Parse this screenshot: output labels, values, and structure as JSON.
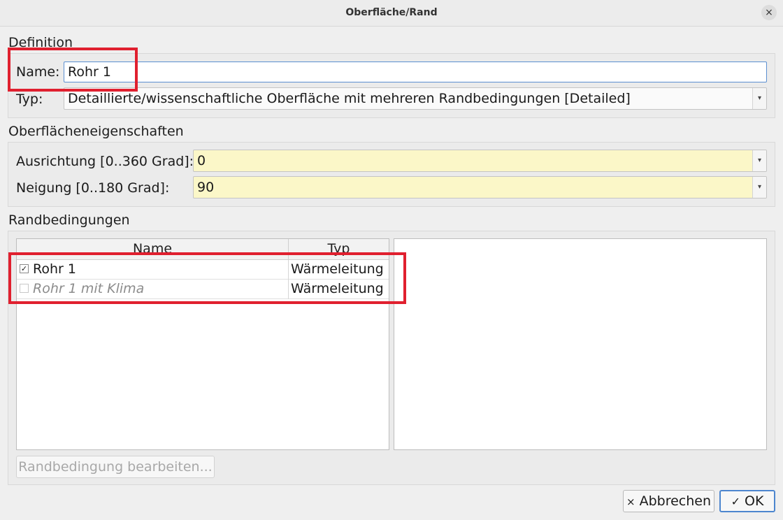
{
  "window": {
    "title": "Oberfläche/Rand",
    "close_glyph": "×"
  },
  "definition": {
    "section_label": "Definition",
    "name_label": "Name:",
    "name_value": "Rohr 1",
    "type_label": "Typ:",
    "type_value": "Detaillierte/wissenschaftliche Oberfläche mit mehreren Randbedingungen [Detailed]"
  },
  "surface": {
    "section_label": "Oberflächeneigenschaften",
    "orientation_label": "Ausrichtung [0..360 Grad]:",
    "orientation_value": "0",
    "inclination_label": "Neigung [0..180 Grad]:",
    "inclination_value": "90"
  },
  "boundary": {
    "section_label": "Randbedingungen",
    "columns": [
      "Name",
      "Typ"
    ],
    "rows": [
      {
        "checked": true,
        "name": "Rohr 1",
        "type": "Wärmeleitung"
      },
      {
        "checked": false,
        "name": "Rohr 1 mit Klima",
        "type": "Wärmeleitung"
      }
    ],
    "edit_button": "Randbedingung bearbeiten..."
  },
  "buttons": {
    "cancel_glyph": "×",
    "cancel": "Abbrechen",
    "ok_glyph": "✓",
    "ok": "OK"
  },
  "icons": {
    "check_glyph": "✓",
    "dropdown_glyph": "▾"
  }
}
